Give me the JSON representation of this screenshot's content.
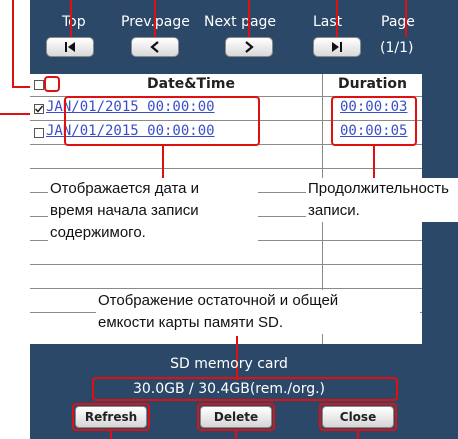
{
  "nav": {
    "top_label": "Top",
    "prev_label": "Prev.page",
    "next_label": "Next page",
    "last_label": "Last",
    "page_label": "Page",
    "page_count": "(1/1)"
  },
  "table": {
    "col_datetime": "Date&Time",
    "col_duration": "Duration",
    "rows": [
      {
        "datetime": "JAN/01/2015 00:00:00",
        "duration": "00:00:03",
        "checked": true
      },
      {
        "datetime": "JAN/01/2015 00:00:00",
        "duration": "00:00:05",
        "checked": false
      }
    ]
  },
  "sd": {
    "title": "SD memory card",
    "value": "30.0GB / 30.4GB(rem./org.)"
  },
  "actions": {
    "refresh": "Refresh",
    "delete": "Delete",
    "close": "Close"
  },
  "callouts": {
    "datetime_line1": "Отображается дата и",
    "datetime_line2": "время начала записи",
    "datetime_line3": "содержимого.",
    "duration_line1": "Продолжительность",
    "duration_line2": "записи.",
    "capacity_line1": "Отображение остаточной и общей",
    "capacity_line2": "емкости карты памяти SD."
  },
  "colors": {
    "panel": "#2c4868",
    "highlight": "#e01010",
    "link": "#3a4ec8"
  }
}
